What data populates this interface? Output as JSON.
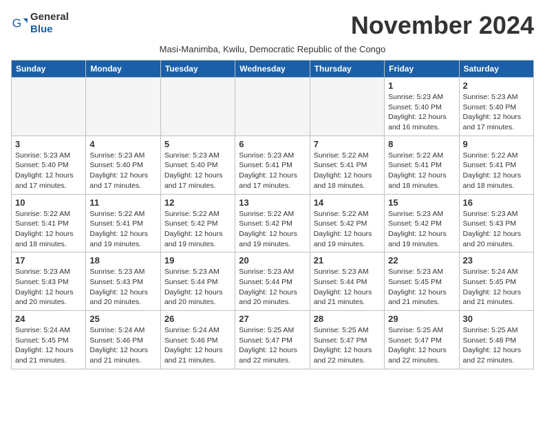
{
  "logo": {
    "general": "General",
    "blue": "Blue"
  },
  "title": "November 2024",
  "subtitle": "Masi-Manimba, Kwilu, Democratic Republic of the Congo",
  "days_of_week": [
    "Sunday",
    "Monday",
    "Tuesday",
    "Wednesday",
    "Thursday",
    "Friday",
    "Saturday"
  ],
  "weeks": [
    [
      {
        "day": "",
        "info": ""
      },
      {
        "day": "",
        "info": ""
      },
      {
        "day": "",
        "info": ""
      },
      {
        "day": "",
        "info": ""
      },
      {
        "day": "",
        "info": ""
      },
      {
        "day": "1",
        "info": "Sunrise: 5:23 AM\nSunset: 5:40 PM\nDaylight: 12 hours and 16 minutes."
      },
      {
        "day": "2",
        "info": "Sunrise: 5:23 AM\nSunset: 5:40 PM\nDaylight: 12 hours and 17 minutes."
      }
    ],
    [
      {
        "day": "3",
        "info": "Sunrise: 5:23 AM\nSunset: 5:40 PM\nDaylight: 12 hours and 17 minutes."
      },
      {
        "day": "4",
        "info": "Sunrise: 5:23 AM\nSunset: 5:40 PM\nDaylight: 12 hours and 17 minutes."
      },
      {
        "day": "5",
        "info": "Sunrise: 5:23 AM\nSunset: 5:40 PM\nDaylight: 12 hours and 17 minutes."
      },
      {
        "day": "6",
        "info": "Sunrise: 5:23 AM\nSunset: 5:41 PM\nDaylight: 12 hours and 17 minutes."
      },
      {
        "day": "7",
        "info": "Sunrise: 5:22 AM\nSunset: 5:41 PM\nDaylight: 12 hours and 18 minutes."
      },
      {
        "day": "8",
        "info": "Sunrise: 5:22 AM\nSunset: 5:41 PM\nDaylight: 12 hours and 18 minutes."
      },
      {
        "day": "9",
        "info": "Sunrise: 5:22 AM\nSunset: 5:41 PM\nDaylight: 12 hours and 18 minutes."
      }
    ],
    [
      {
        "day": "10",
        "info": "Sunrise: 5:22 AM\nSunset: 5:41 PM\nDaylight: 12 hours and 18 minutes."
      },
      {
        "day": "11",
        "info": "Sunrise: 5:22 AM\nSunset: 5:41 PM\nDaylight: 12 hours and 19 minutes."
      },
      {
        "day": "12",
        "info": "Sunrise: 5:22 AM\nSunset: 5:42 PM\nDaylight: 12 hours and 19 minutes."
      },
      {
        "day": "13",
        "info": "Sunrise: 5:22 AM\nSunset: 5:42 PM\nDaylight: 12 hours and 19 minutes."
      },
      {
        "day": "14",
        "info": "Sunrise: 5:22 AM\nSunset: 5:42 PM\nDaylight: 12 hours and 19 minutes."
      },
      {
        "day": "15",
        "info": "Sunrise: 5:23 AM\nSunset: 5:42 PM\nDaylight: 12 hours and 19 minutes."
      },
      {
        "day": "16",
        "info": "Sunrise: 5:23 AM\nSunset: 5:43 PM\nDaylight: 12 hours and 20 minutes."
      }
    ],
    [
      {
        "day": "17",
        "info": "Sunrise: 5:23 AM\nSunset: 5:43 PM\nDaylight: 12 hours and 20 minutes."
      },
      {
        "day": "18",
        "info": "Sunrise: 5:23 AM\nSunset: 5:43 PM\nDaylight: 12 hours and 20 minutes."
      },
      {
        "day": "19",
        "info": "Sunrise: 5:23 AM\nSunset: 5:44 PM\nDaylight: 12 hours and 20 minutes."
      },
      {
        "day": "20",
        "info": "Sunrise: 5:23 AM\nSunset: 5:44 PM\nDaylight: 12 hours and 20 minutes."
      },
      {
        "day": "21",
        "info": "Sunrise: 5:23 AM\nSunset: 5:44 PM\nDaylight: 12 hours and 21 minutes."
      },
      {
        "day": "22",
        "info": "Sunrise: 5:23 AM\nSunset: 5:45 PM\nDaylight: 12 hours and 21 minutes."
      },
      {
        "day": "23",
        "info": "Sunrise: 5:24 AM\nSunset: 5:45 PM\nDaylight: 12 hours and 21 minutes."
      }
    ],
    [
      {
        "day": "24",
        "info": "Sunrise: 5:24 AM\nSunset: 5:45 PM\nDaylight: 12 hours and 21 minutes."
      },
      {
        "day": "25",
        "info": "Sunrise: 5:24 AM\nSunset: 5:46 PM\nDaylight: 12 hours and 21 minutes."
      },
      {
        "day": "26",
        "info": "Sunrise: 5:24 AM\nSunset: 5:46 PM\nDaylight: 12 hours and 21 minutes."
      },
      {
        "day": "27",
        "info": "Sunrise: 5:25 AM\nSunset: 5:47 PM\nDaylight: 12 hours and 22 minutes."
      },
      {
        "day": "28",
        "info": "Sunrise: 5:25 AM\nSunset: 5:47 PM\nDaylight: 12 hours and 22 minutes."
      },
      {
        "day": "29",
        "info": "Sunrise: 5:25 AM\nSunset: 5:47 PM\nDaylight: 12 hours and 22 minutes."
      },
      {
        "day": "30",
        "info": "Sunrise: 5:25 AM\nSunset: 5:48 PM\nDaylight: 12 hours and 22 minutes."
      }
    ]
  ]
}
